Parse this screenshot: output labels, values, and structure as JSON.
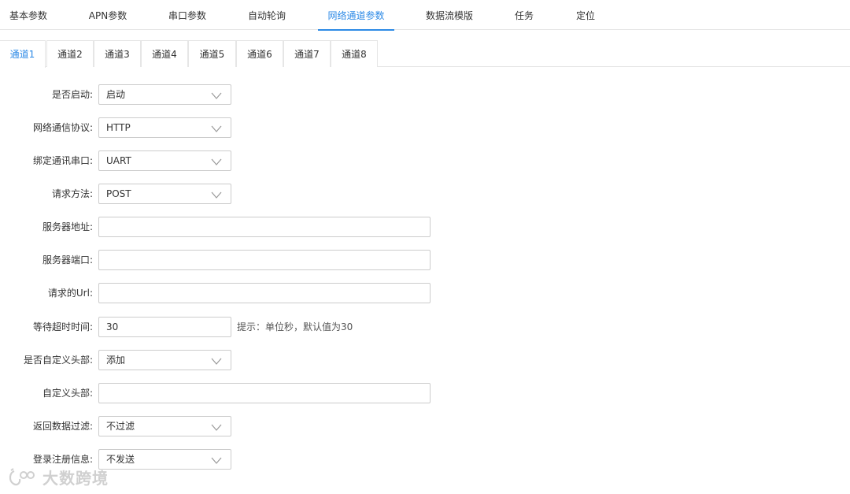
{
  "top_tabs": [
    "基本参数",
    "APN参数",
    "串口参数",
    "自动轮询",
    "网络通道参数",
    "数据流模版",
    "任务",
    "定位"
  ],
  "top_active_index": 4,
  "channel_tabs": [
    "通道1",
    "通道2",
    "通道3",
    "通道4",
    "通道5",
    "通道6",
    "通道7",
    "通道8"
  ],
  "channel_active_index": 0,
  "form": {
    "enable": {
      "label": "是否启动:",
      "value": "启动"
    },
    "protocol": {
      "label": "网络通信协议:",
      "value": "HTTP"
    },
    "bind_uart": {
      "label": "绑定通讯串口:",
      "value": "UART"
    },
    "method": {
      "label": "请求方法:",
      "value": "POST"
    },
    "server_addr": {
      "label": "服务器地址:",
      "value": ""
    },
    "server_port": {
      "label": "服务器端口:",
      "value": ""
    },
    "url": {
      "label": "请求的Url:",
      "value": ""
    },
    "timeout": {
      "label": "等待超时时间:",
      "value": "30",
      "hint": "提示：单位秒，默认值为30"
    },
    "custom_header_toggle": {
      "label": "是否自定义头部:",
      "value": "添加"
    },
    "custom_header": {
      "label": "自定义头部:",
      "value": ""
    },
    "filter": {
      "label": "返回数据过滤:",
      "value": "不过滤"
    },
    "register_info": {
      "label": "登录注册信息:",
      "value": "不发送"
    }
  },
  "watermark": "大数跨境",
  "colors": {
    "accent": "#2d8ae6",
    "border": "#cccccc",
    "divider": "#e6e6e6"
  }
}
